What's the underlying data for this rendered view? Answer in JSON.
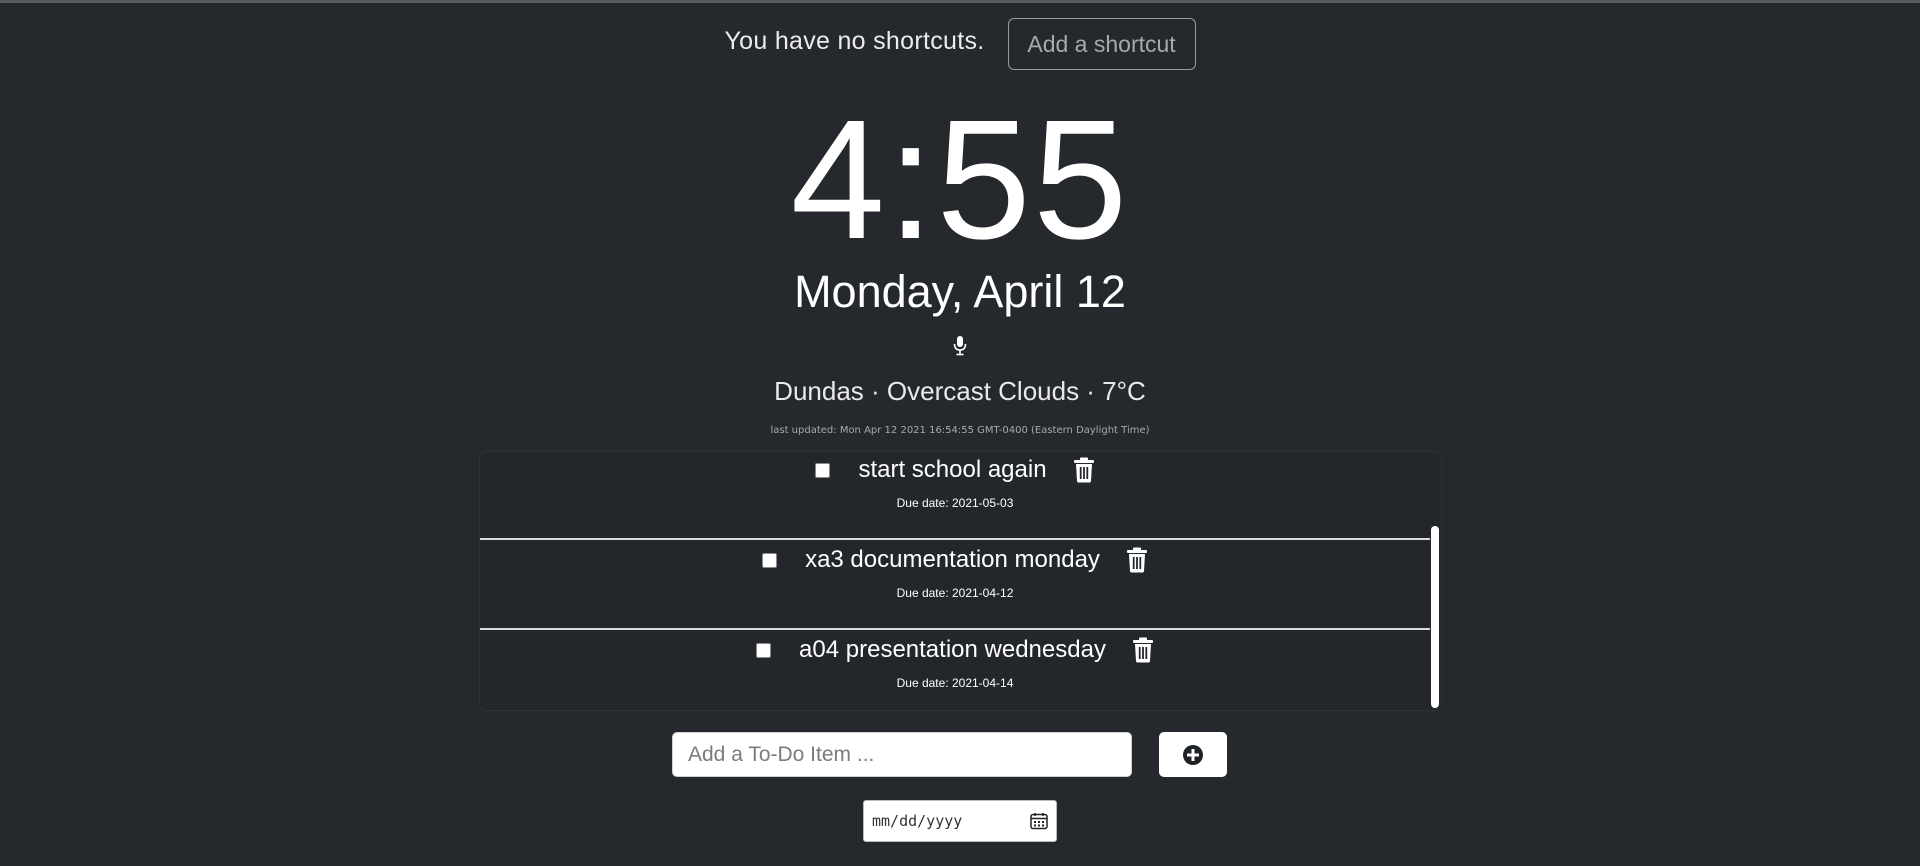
{
  "shortcuts": {
    "message": "You have no shortcuts.",
    "add_label": "Add a shortcut"
  },
  "clock": {
    "time": "4:55",
    "date": "Monday, April 12"
  },
  "weather": {
    "summary": "Dundas · Overcast Clouds · 7°C",
    "last_updated": "last updated: Mon Apr 12 2021 16:54:55 GMT-0400 (Eastern Daylight Time)"
  },
  "todos": [
    {
      "text": "start school again",
      "due": "Due date: 2021-05-03"
    },
    {
      "text": "xa3 documentation monday",
      "due": "Due date: 2021-04-12"
    },
    {
      "text": "a04 presentation wednesday",
      "due": "Due date: 2021-04-14"
    }
  ],
  "todo_form": {
    "placeholder": "Add a To-Do Item ...",
    "date_placeholder": "mm/dd/yyyy"
  },
  "icons": {
    "mic": "microphone-icon",
    "trash": "trash-icon",
    "add": "plus-circle-icon",
    "calendar": "calendar-icon"
  }
}
